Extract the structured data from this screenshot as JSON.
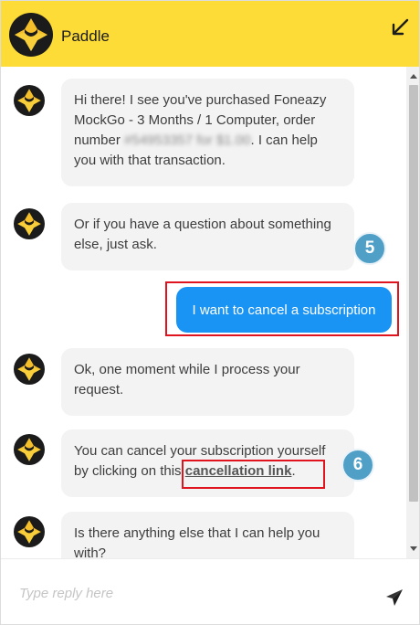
{
  "header": {
    "title": "Paddle",
    "minimize_icon": "arrow-down-left-icon",
    "bg_color": "#fddc37"
  },
  "messages": [
    {
      "from": "bot",
      "text_before": "Hi there! I see you've purchased Foneazy MockGo - 3 Months / 1 Computer, order number ",
      "text_blurred": "#54953357 for $1.00",
      "text_after": ". I can help you with that transaction."
    },
    {
      "from": "bot",
      "text": "Or if you have a question about something else, just ask."
    },
    {
      "from": "user",
      "text": "I want to cancel a subscription"
    },
    {
      "from": "bot",
      "text": "Ok, one moment while I process your request."
    },
    {
      "from": "bot",
      "text_before": "You can cancel your subscription yourself by clicking on this ",
      "link_text": "cancellation link",
      "text_after": "."
    },
    {
      "from": "bot",
      "text": "Is there anything else that I can help you with?"
    }
  ],
  "annotations": {
    "step_5": "5",
    "step_6": "6",
    "highlight_color": "#e0141e",
    "badge_color": "#4f9fc7"
  },
  "composer": {
    "placeholder": "Type reply here",
    "send_icon": "paper-plane-icon"
  },
  "colors": {
    "user_bubble": "#1a94f4",
    "bot_bubble": "#f3f3f4"
  }
}
